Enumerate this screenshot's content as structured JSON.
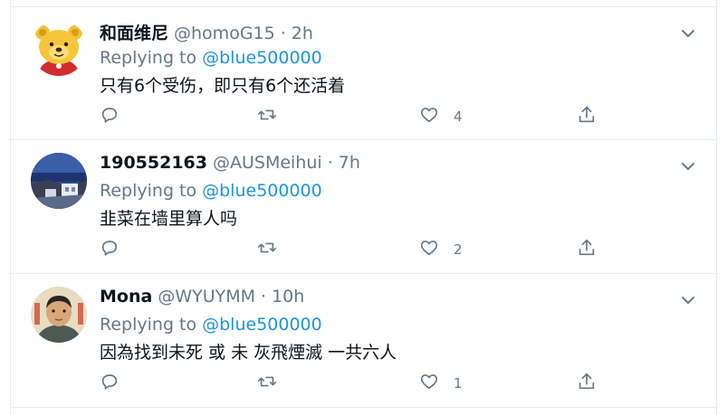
{
  "tweets": [
    {
      "name": "和面维尼",
      "handle": "@homoG15",
      "time": "2h",
      "replying_label": "Replying to",
      "replying_to": "@blue500000",
      "text": "只有6个受伤，即只有6个还活着",
      "likes": "4"
    },
    {
      "name": "190552163",
      "handle": "@AUSMeihui",
      "time": "7h",
      "replying_label": "Replying to",
      "replying_to": "@blue500000",
      "text": "韭菜在墙里算人吗",
      "likes": "2"
    },
    {
      "name": "Mona",
      "handle": "@WYUYMM",
      "time": "10h",
      "replying_label": "Replying to",
      "replying_to": "@blue500000",
      "text": "因為找到未死 或 未 灰飛煙滅 一共六人",
      "likes": "1"
    }
  ],
  "dot": "·",
  "icons": [
    "chevron-down-icon",
    "reply-icon",
    "retweet-icon",
    "like-icon",
    "share-icon"
  ],
  "colors": {
    "mention": "#1b95e0",
    "secondary": "#657786",
    "border": "#e6ecf0"
  }
}
